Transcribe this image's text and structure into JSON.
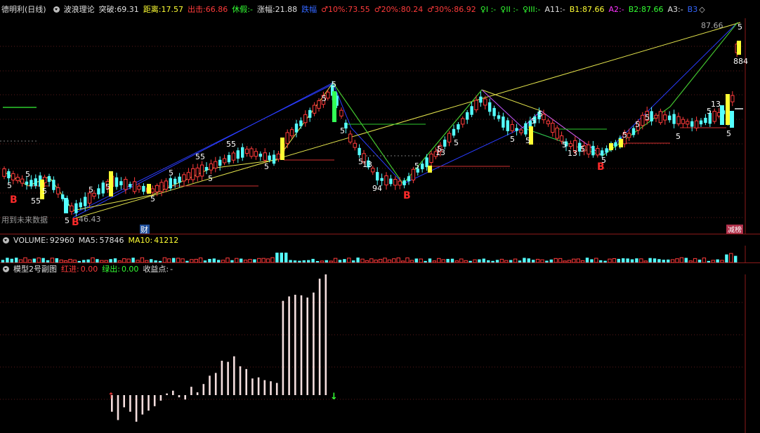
{
  "header": {
    "stock_name": "德明利(日线)",
    "indicator_name": "波浪理论",
    "breakout_label": "突破:",
    "breakout_value": "69.31",
    "distance_label": "距离:",
    "distance_value": "17.57",
    "exit_label": "出击:",
    "exit_value": "66.86",
    "rest_label": "休假:",
    "rest_value": "-",
    "amplitude_label": "涨幅:",
    "amplitude_value": "21.88",
    "range_label": "跌幅",
    "p10_label": "♂10%:",
    "p10_value": "73.55",
    "p20_label": "♂20%:",
    "p20_value": "80.24",
    "p30_label": "♂30%:",
    "p30_value": "86.92",
    "q1_label": "♀I :",
    "q1_value": "-",
    "q2_label": "♀II :",
    "q2_value": "-",
    "q3_label": "♀III:",
    "q3_value": "-",
    "a11_label": "A11:",
    "a11_value": "-",
    "b1_label": "B1:",
    "b1_value": "87.66",
    "a2_label": "A2:",
    "a2_value": "-",
    "b2_label": "B2:",
    "b2_value": "87.66",
    "a3_label": "A3:",
    "a3_value": "-",
    "b3_label": "B3"
  },
  "main_chart": {
    "high_label": "87.66",
    "low_label": "46.43",
    "future_data_note": "用到未来数据",
    "finance_tag": "财",
    "rank_tag": "减榜",
    "buy_marks": [
      "B",
      "B",
      "B",
      "B"
    ],
    "wave_labels": [
      "5",
      "5",
      "5",
      "5",
      "5",
      "5",
      "5",
      "5",
      "5",
      "5",
      "5",
      "5",
      "5",
      "5",
      "5",
      "5",
      "5",
      "5",
      "5",
      "5",
      "5",
      "5",
      "5",
      "5",
      "5",
      "5",
      "5",
      "5",
      "5",
      "5",
      "5"
    ],
    "misc_labels": [
      "55",
      "55",
      "55",
      "13",
      "13",
      "13",
      "94",
      "13",
      "884"
    ],
    "colors": {
      "up": "#ff3b3b",
      "down": "#54ffff",
      "signal": "#ffff33",
      "blue_line": "#2a3cff",
      "yellow_line": "#e6e64d",
      "green_line": "#2ecc2e"
    }
  },
  "volume_panel": {
    "label": "VOLUME:",
    "value": "92960",
    "ma5_label": "MA5:",
    "ma5_value": "57846",
    "ma10_label": "MA10:",
    "ma10_value": "41212"
  },
  "sub_chart": {
    "title": "模型2号副图",
    "red_in_label": "红进:",
    "red_in_value": "0.00",
    "green_out_label": "绿出:",
    "green_out_value": "0.00",
    "profit_label": "收益点:",
    "profit_value": "-",
    "bars": [
      -30,
      -45,
      -22,
      -30,
      -48,
      -35,
      -28,
      -20,
      -10,
      3,
      8,
      -4,
      -8,
      15,
      5,
      20,
      35,
      40,
      62,
      60,
      70,
      52,
      47,
      30,
      32,
      27,
      25,
      22,
      170,
      178,
      181,
      180,
      176,
      185,
      210,
      222
    ]
  }
}
